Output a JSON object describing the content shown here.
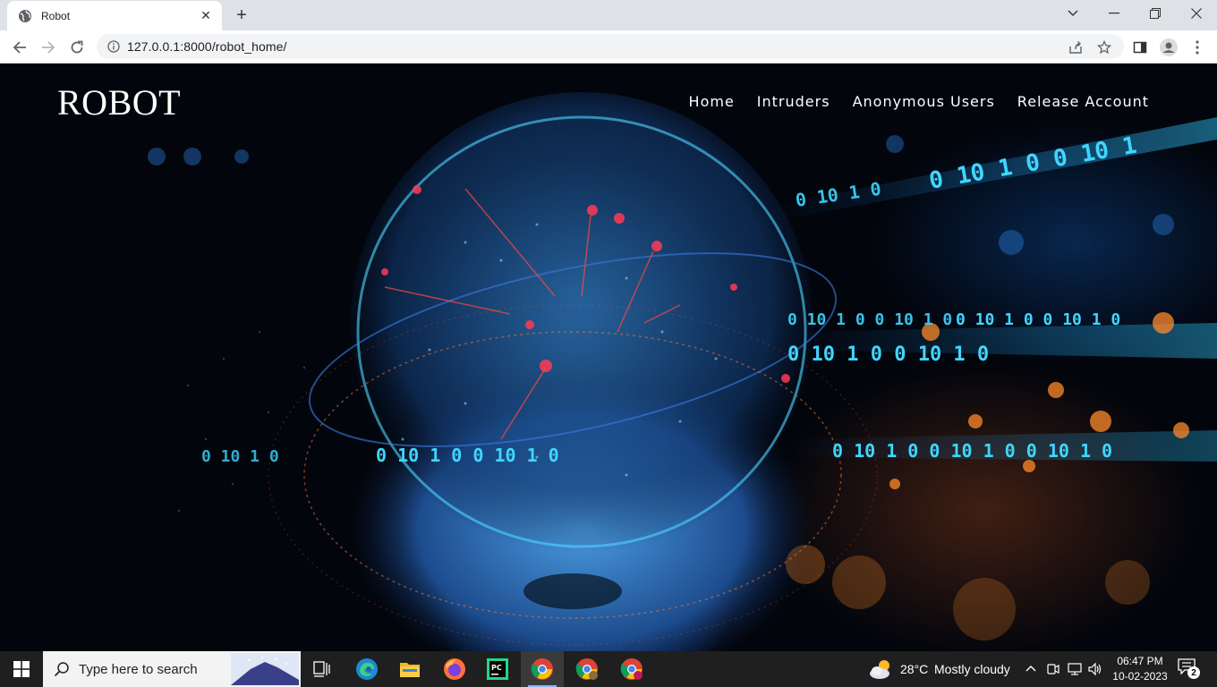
{
  "browser": {
    "tab_title": "Robot",
    "url": "127.0.0.1:8000/robot_home/"
  },
  "site": {
    "logo": "ROBOT",
    "nav": [
      "Home",
      "Intruders",
      "Anonymous Users",
      "Release Account"
    ]
  },
  "hero": {
    "binary_rows": [
      "0 10 1 0 0 10 1",
      "0 10 1 0",
      "0 10 1 0 0 10 1 0",
      "0 10 1 0 0 10 1 0",
      "0 10 1 0 0 10 1 0",
      "0 10 1 0",
      "0 10 1 0 0 10 1 0",
      "0 10 1 0 0 10 1 0 0 10 1 0"
    ]
  },
  "taskbar": {
    "search_placeholder": "Type here to search",
    "weather_temp": "28°C",
    "weather_desc": "Mostly cloudy",
    "time": "06:47 PM",
    "date": "10-02-2023",
    "notification_count": "2"
  },
  "colors": {
    "chrome_tabbar": "#dee1e6",
    "taskbar_bg": "#1f1f1f",
    "binary_cyan": "#3fd6ff",
    "accent_orange": "#ff8a2a"
  }
}
